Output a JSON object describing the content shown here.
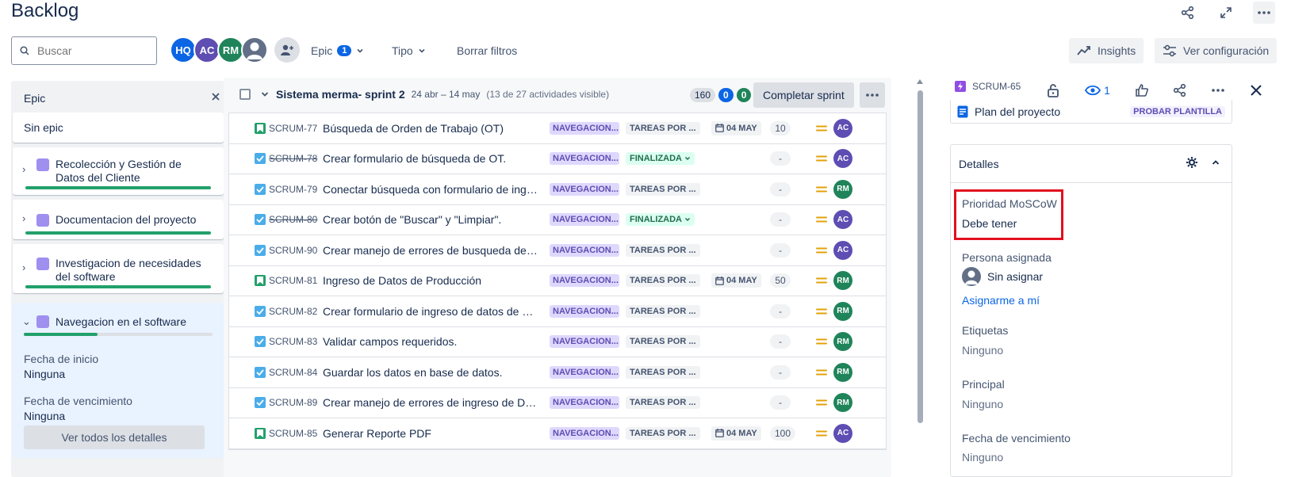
{
  "page": {
    "title": "Backlog"
  },
  "toolbar": {
    "search_placeholder": "Buscar",
    "avatars": [
      {
        "initials": "HQ",
        "color": "#0c66e4"
      },
      {
        "initials": "AC",
        "color": "#5e4db2"
      },
      {
        "initials": "RM",
        "color": "#1f845a"
      }
    ],
    "epic_label": "Epic",
    "epic_count": "1",
    "tipo_label": "Tipo",
    "clear_filters": "Borrar filtros",
    "insights": "Insights",
    "settings": "Ver configuración"
  },
  "epics": {
    "title": "Epic",
    "no_epic": "Sin epic",
    "items": [
      {
        "name_line1": "Recolección y Gestión de",
        "name_line2": "Datos del Cliente"
      },
      {
        "name_line1": "Documentacion del proyecto",
        "name_line2": ""
      },
      {
        "name_line1": "Investigacion de necesidades",
        "name_line2": "del software"
      }
    ],
    "open": {
      "name": "Navegacion en el software",
      "progress_fraction": 0.39,
      "start_label": "Fecha de inicio",
      "start_value": "Ninguna",
      "due_label": "Fecha de vencimiento",
      "due_value": "Ninguna",
      "see_all": "Ver todos los detalles"
    }
  },
  "sprint": {
    "name": "Sistema merma- sprint 2",
    "dates": "24 abr – 14 may",
    "visible": "(13 de 27 actividades visible)",
    "points_total": "160",
    "points_progress": "0",
    "points_done": "0",
    "complete": "Completar sprint",
    "rows": [
      {
        "type": "story",
        "key": "SCRUM-77",
        "done": false,
        "summary": "Búsqueda de Orden de Trabajo (OT)",
        "epic": "NAVEGACION...",
        "status": "TAREAS POR ...",
        "status_kind": "todo",
        "due": "04 MAY",
        "estimate": "10",
        "assignee": "AC",
        "assignee_color": "#5e4db2"
      },
      {
        "type": "task",
        "key": "SCRUM-78",
        "done": true,
        "summary": "Crear formulario de búsqueda de OT.",
        "epic": "NAVEGACION...",
        "status": "FINALIZADA",
        "status_kind": "done",
        "due": "",
        "estimate": "-",
        "assignee": "AC",
        "assignee_color": "#5e4db2"
      },
      {
        "type": "task",
        "key": "SCRUM-79",
        "done": false,
        "summary": "Conectar búsqueda con formulario de ingre...",
        "epic": "NAVEGACION...",
        "status": "TAREAS POR ...",
        "status_kind": "todo",
        "due": "",
        "estimate": "-",
        "assignee": "RM",
        "assignee_color": "#1f845a"
      },
      {
        "type": "task",
        "key": "SCRUM-80",
        "done": true,
        "summary": "Crear botón de \"Buscar\" y \"Limpiar\".",
        "epic": "NAVEGACION...",
        "status": "FINALIZADA",
        "status_kind": "done",
        "due": "",
        "estimate": "-",
        "assignee": "AC",
        "assignee_color": "#5e4db2"
      },
      {
        "type": "task",
        "key": "SCRUM-90",
        "done": false,
        "summary": "Crear manejo de errores de busqueda de OT",
        "epic": "NAVEGACION...",
        "status": "TAREAS POR ...",
        "status_kind": "todo",
        "due": "",
        "estimate": "-",
        "assignee": "AC",
        "assignee_color": "#5e4db2"
      },
      {
        "type": "story",
        "key": "SCRUM-81",
        "done": false,
        "summary": "Ingreso de Datos de Producción",
        "epic": "NAVEGACION...",
        "status": "TAREAS POR ...",
        "status_kind": "todo",
        "due": "04 MAY",
        "estimate": "50",
        "assignee": "RM",
        "assignee_color": "#1f845a"
      },
      {
        "type": "task",
        "key": "SCRUM-82",
        "done": false,
        "summary": "Crear formulario de ingreso de datos de pr...",
        "epic": "NAVEGACION...",
        "status": "TAREAS POR ...",
        "status_kind": "todo",
        "due": "",
        "estimate": "-",
        "assignee": "RM",
        "assignee_color": "#1f845a"
      },
      {
        "type": "task",
        "key": "SCRUM-83",
        "done": false,
        "summary": "Validar campos requeridos.",
        "epic": "NAVEGACION...",
        "status": "TAREAS POR ...",
        "status_kind": "todo",
        "due": "",
        "estimate": "-",
        "assignee": "RM",
        "assignee_color": "#1f845a"
      },
      {
        "type": "task",
        "key": "SCRUM-84",
        "done": false,
        "summary": "Guardar los datos en base de datos.",
        "epic": "NAVEGACION...",
        "status": "TAREAS POR ...",
        "status_kind": "todo",
        "due": "",
        "estimate": "-",
        "assignee": "RM",
        "assignee_color": "#1f845a"
      },
      {
        "type": "task",
        "key": "SCRUM-89",
        "done": false,
        "summary": "Crear manejo de errores de ingreso de Dat...",
        "epic": "NAVEGACION...",
        "status": "TAREAS POR ...",
        "status_kind": "todo",
        "due": "",
        "estimate": "-",
        "assignee": "RM",
        "assignee_color": "#1f845a"
      },
      {
        "type": "story",
        "key": "SCRUM-85",
        "done": false,
        "summary": "Generar Reporte PDF",
        "epic": "NAVEGACION...",
        "status": "TAREAS POR ...",
        "status_kind": "todo",
        "due": "04 MAY",
        "estimate": "100",
        "assignee": "AC",
        "assignee_color": "#5e4db2"
      }
    ]
  },
  "detail": {
    "key": "SCRUM-65",
    "watchers": "1",
    "parent_name": "Plan del proyecto",
    "parent_tag": "PROBAR PLANTILLA",
    "section_title": "Detalles",
    "moscow_label": "Prioridad MoSCoW",
    "moscow_value": "Debe tener",
    "assignee_label": "Persona asignada",
    "assignee_value": "Sin asignar",
    "assign_me": "Asignarme a mí",
    "labels_label": "Etiquetas",
    "labels_value": "Ninguno",
    "principal_label": "Principal",
    "principal_value": "Ninguno",
    "due_label": "Fecha de vencimiento",
    "due_value": "Ninguno"
  }
}
